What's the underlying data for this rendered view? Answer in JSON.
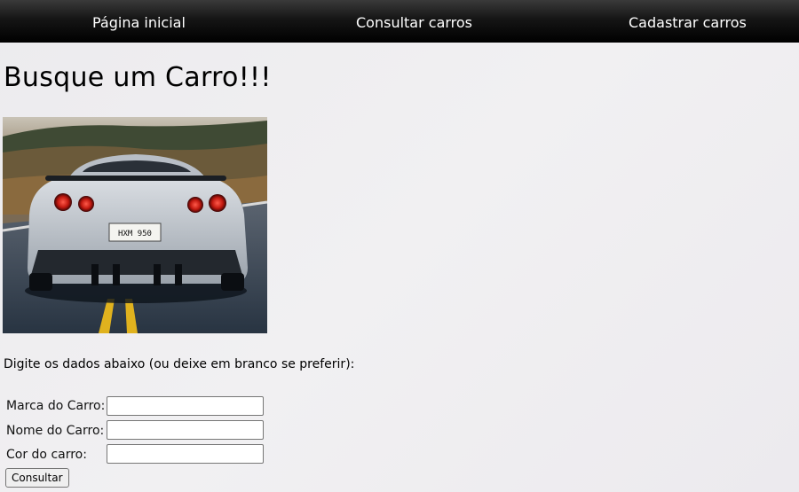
{
  "nav": {
    "home": "Página inicial",
    "consult": "Consultar carros",
    "register": "Cadastrar carros"
  },
  "page": {
    "title": "Busque um Carro!!!",
    "instructions": "Digite os dados abaixo (ou deixe em branco se preferir):"
  },
  "image": {
    "plate_text": "HXM 950"
  },
  "form": {
    "marca_label": "Marca do Carro:",
    "marca_value": "",
    "nome_label": "Nome do Carro:",
    "nome_value": "",
    "cor_label": "Cor do carro:",
    "cor_value": "",
    "submit_label": "Consultar"
  }
}
